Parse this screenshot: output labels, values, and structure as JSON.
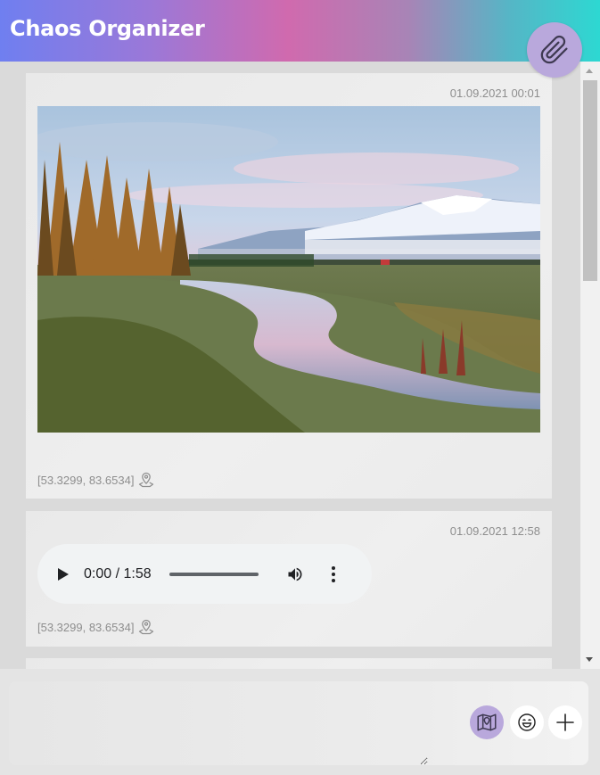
{
  "app": {
    "title": "Chaos Organizer"
  },
  "header": {
    "attach_icon": "paperclip-icon"
  },
  "posts": [
    {
      "type": "image",
      "timestamp": "01.09.2021 00:01",
      "image_description": "photo",
      "coords": "[53.3299, 83.6534]",
      "location_icon": "map-pin-icon"
    },
    {
      "type": "audio",
      "timestamp": "01.09.2021 12:58",
      "audio_time": "0:00 / 1:58",
      "audio_progress": 0,
      "coords": "[53.3299, 83.6534]",
      "location_icon": "map-pin-icon"
    }
  ],
  "composer": {
    "input_value": "",
    "placeholder": "",
    "buttons": [
      "map-icon",
      "smile-icon",
      "plus-icon"
    ]
  },
  "colors": {
    "accent": "#b9a8dc",
    "header_gradient": [
      "#6f7ff0",
      "#d06aae",
      "#2dd8d2"
    ],
    "meta_text": "#8e8e8e"
  }
}
